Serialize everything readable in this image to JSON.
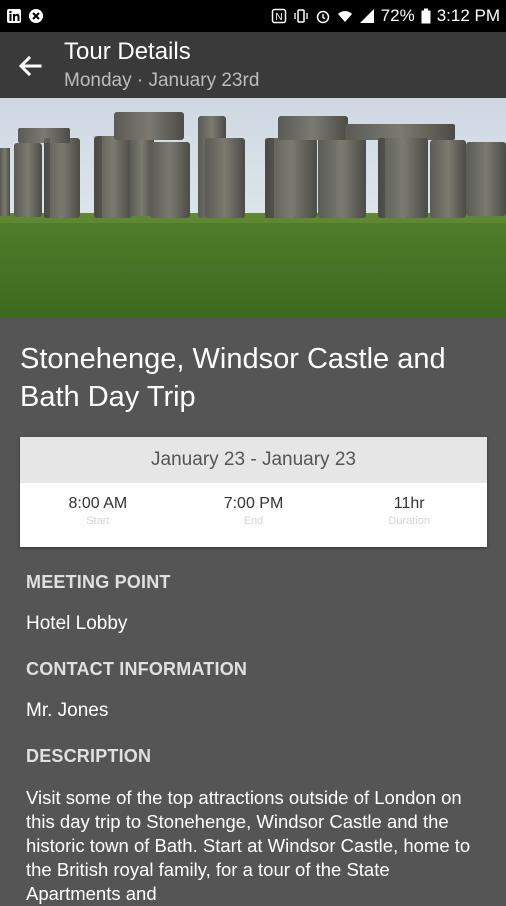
{
  "status_bar": {
    "battery": "72%",
    "time": "3:12 PM",
    "icons": [
      "linkedin-icon",
      "app-icon",
      "nfc-icon",
      "vibrate-icon",
      "alarm-icon",
      "wifi-icon",
      "signal-icon",
      "battery-icon"
    ]
  },
  "app_bar": {
    "back_icon": "arrow-back-icon",
    "title": "Tour Details",
    "subtitle": "Monday · January 23rd"
  },
  "hero_image": {
    "subject": "stonehenge-photo"
  },
  "tour": {
    "title": "Stonehenge, Windsor Castle and Bath Day Trip",
    "date_range": "January 23 - January 23",
    "start": {
      "value": "8:00 AM",
      "label": "Start"
    },
    "end": {
      "value": "7:00 PM",
      "label": "End"
    },
    "duration": {
      "value": "11hr",
      "label": "Duration"
    }
  },
  "meeting_point": {
    "heading": "MEETING POINT",
    "value": "Hotel Lobby"
  },
  "contact": {
    "heading": "CONTACT INFORMATION",
    "value": "Mr. Jones"
  },
  "description": {
    "heading": "DESCRIPTION",
    "text": "Visit some of the top attractions outside of London on this day trip to Stonehenge, Windsor Castle and the historic town of Bath. Start at Windsor Castle, home to the British royal family, for a tour of the State Apartments and"
  }
}
